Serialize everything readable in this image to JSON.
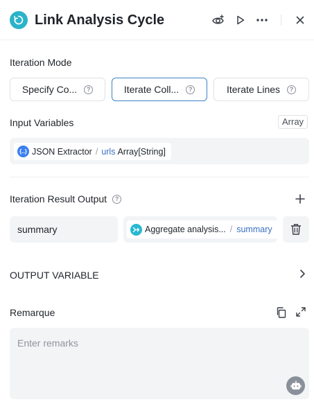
{
  "header": {
    "title": "Link Analysis Cycle",
    "icons": [
      "loop-icon",
      "eye-icon",
      "play-icon",
      "more-icon",
      "close-icon"
    ]
  },
  "iteration_mode": {
    "label": "Iteration Mode",
    "options": [
      {
        "label": "Specify Co...",
        "active": false
      },
      {
        "label": "Iterate Coll...",
        "active": true
      },
      {
        "label": "Iterate Lines",
        "active": false
      }
    ]
  },
  "input_variables": {
    "label": "Input Variables",
    "type_badge": "Array",
    "source": "JSON Extractor",
    "separator": "/",
    "var_name": "urls",
    "var_type": "Array[String]"
  },
  "iteration_result": {
    "label": "Iteration Result Output",
    "output_name": "summary",
    "ref_source": "Aggregate analysis...",
    "separator": "/",
    "ref_var": "summary"
  },
  "output_variable": {
    "label": "OUTPUT VARIABLE"
  },
  "remarks": {
    "label": "Remarque",
    "placeholder": "Enter remarks",
    "value": ""
  },
  "colors": {
    "accent": "#2bb3c9",
    "active_border": "#3b82c4",
    "link_blue": "#3b70c4"
  }
}
